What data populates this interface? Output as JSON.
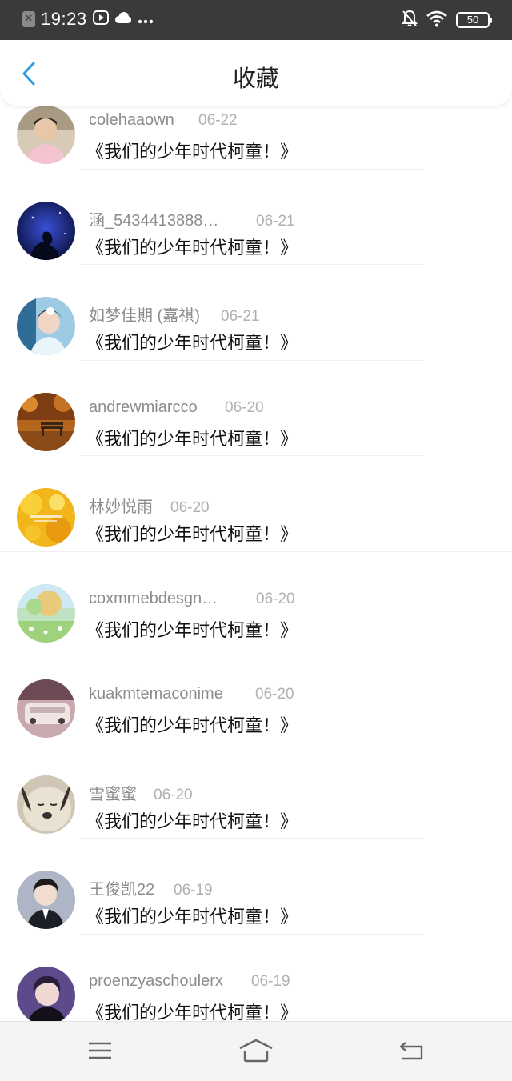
{
  "status_bar": {
    "time": "19:23",
    "battery": "50"
  },
  "header": {
    "title": "收藏"
  },
  "colors": {
    "accent": "#2c9be6",
    "status_bg": "#3a3a3a",
    "name_gray": "#8c8c8c"
  },
  "items": [
    {
      "username": "colehaaown",
      "date": "06-22",
      "title": "《我们的少年时代柯童！》"
    },
    {
      "username": "涵_5434413888…",
      "date": "06-21",
      "title": "《我们的少年时代柯童！》"
    },
    {
      "username": "如梦佳期 (嘉祺)",
      "date": "06-21",
      "title": "《我们的少年时代柯童！》"
    },
    {
      "username": "andrewmiarcco",
      "date": "06-20",
      "title": "《我们的少年时代柯童！》"
    },
    {
      "username": "林妙悦雨",
      "date": "06-20",
      "title": "《我们的少年时代柯童！》"
    },
    {
      "username": "coxmmebdesgn…",
      "date": "06-20",
      "title": "《我们的少年时代柯童！》"
    },
    {
      "username": "kuakmtemaconime",
      "date": "06-20",
      "title": "《我们的少年时代柯童！》"
    },
    {
      "username": "雪蜜蜜",
      "date": "06-20",
      "title": "《我们的少年时代柯童！》"
    },
    {
      "username": "王俊凯22",
      "date": "06-19",
      "title": "《我们的少年时代柯童！》"
    },
    {
      "username": "proenzyaschoulerx",
      "date": "06-19",
      "title": "《我们的少年时代柯童！》"
    }
  ],
  "icons": {
    "back": "chevron-left-icon",
    "nav_menu": "menu-icon",
    "nav_home": "home-icon",
    "nav_back": "return-icon"
  }
}
